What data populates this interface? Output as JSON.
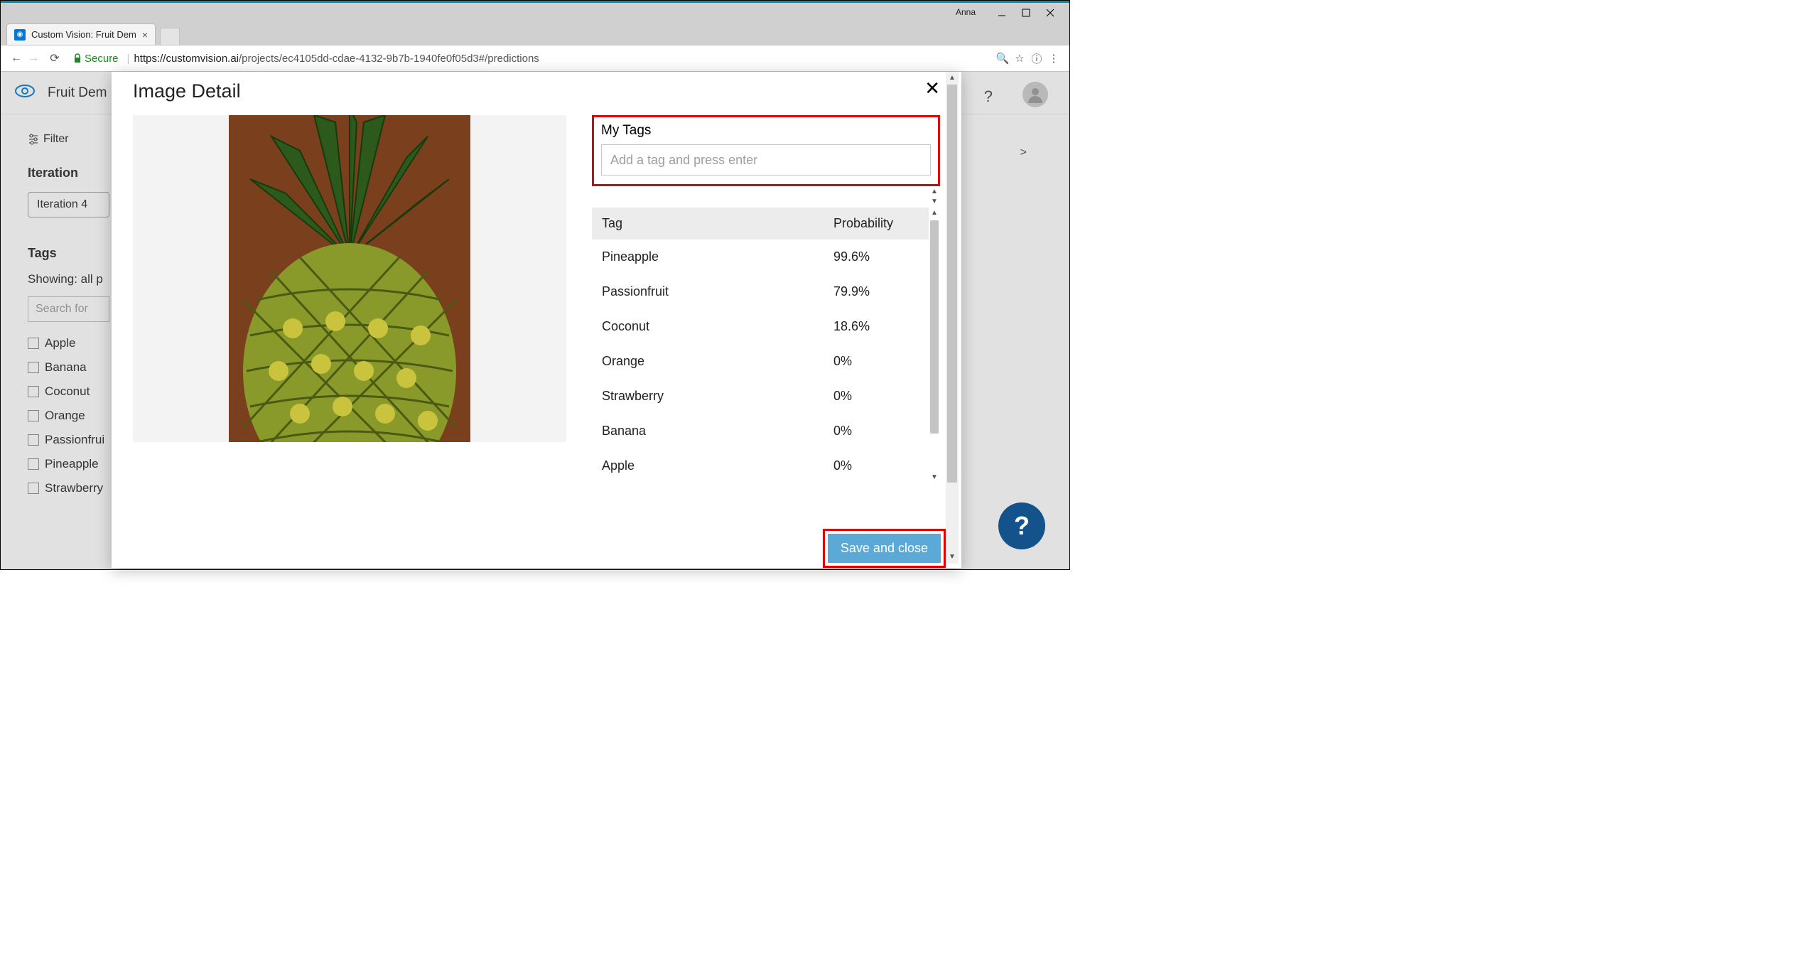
{
  "os": {
    "user": "Anna"
  },
  "browser": {
    "tab_title": "Custom Vision: Fruit Dem",
    "secure_label": "Secure",
    "url_host": "https://customvision.ai",
    "url_path": "/projects/ec4105dd-cdae-4132-9b7b-1940fe0f05d3#/predictions"
  },
  "page": {
    "project_title": "Fruit Dem",
    "filter_label": "Filter",
    "iteration_heading": "Iteration",
    "iteration_selected": "Iteration 4",
    "tags_heading": "Tags",
    "showing_text": "Showing: all p",
    "search_placeholder": "Search for",
    "nav_gt": ">",
    "tag_list": [
      "Apple",
      "Banana",
      "Coconut",
      "Orange",
      "Passionfrui",
      "Pineapple",
      "Strawberry"
    ]
  },
  "modal": {
    "title": "Image Detail",
    "mytags_heading": "My Tags",
    "tag_input_placeholder": "Add a tag and press enter",
    "table": {
      "col_tag": "Tag",
      "col_prob": "Probability",
      "rows": [
        {
          "tag": "Pineapple",
          "prob": "99.6%"
        },
        {
          "tag": "Passionfruit",
          "prob": "79.9%"
        },
        {
          "tag": "Coconut",
          "prob": "18.6%"
        },
        {
          "tag": "Orange",
          "prob": "0%"
        },
        {
          "tag": "Strawberry",
          "prob": "0%"
        },
        {
          "tag": "Banana",
          "prob": "0%"
        },
        {
          "tag": "Apple",
          "prob": "0%"
        }
      ]
    },
    "save_label": "Save and close"
  },
  "help": {
    "glyph": "?"
  }
}
